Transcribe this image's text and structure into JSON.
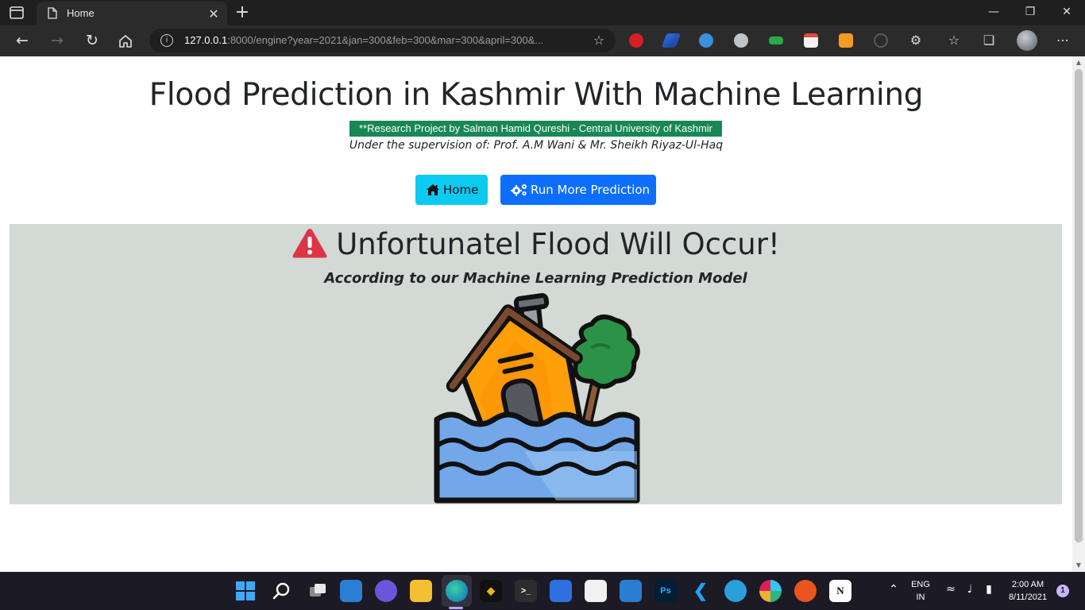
{
  "browser": {
    "tab_title": "Home",
    "tab_close": "✕",
    "new_tab": "+",
    "url_host": "127.0.0.1",
    "url_rest": ":8000/engine?year=2021&jan=300&feb=300&mar=300&april=300&...",
    "window_controls": {
      "minimize": "—",
      "maximize": "❐",
      "close": "✕"
    }
  },
  "page": {
    "title": "Flood Prediction in Kashmir With Machine Learning",
    "subtitle": "**Research Project by Salman Hamid Qureshi - Central University of Kashmir",
    "supervision": "Under the supervision of: Prof. A.M Wani & Mr. Sheikh Riyaz-Ul-Haq",
    "buttons": {
      "home": "Home",
      "run_more": "Run More Prediction"
    },
    "result": {
      "heading": "Unfortunatel Flood Will Occur!",
      "subheading": "According to our Machine Learning Prediction Model"
    }
  },
  "taskbar": {
    "language": "ENG",
    "region": "IN",
    "time": "2:00 AM",
    "date": "8/11/2021",
    "notification_count": "1"
  },
  "colors": {
    "subtitle_bg": "#198754",
    "home_button": "#0dcaf0",
    "run_button": "#0d6efd",
    "result_bg": "#d3d9d5",
    "warning": "#dc3545"
  }
}
